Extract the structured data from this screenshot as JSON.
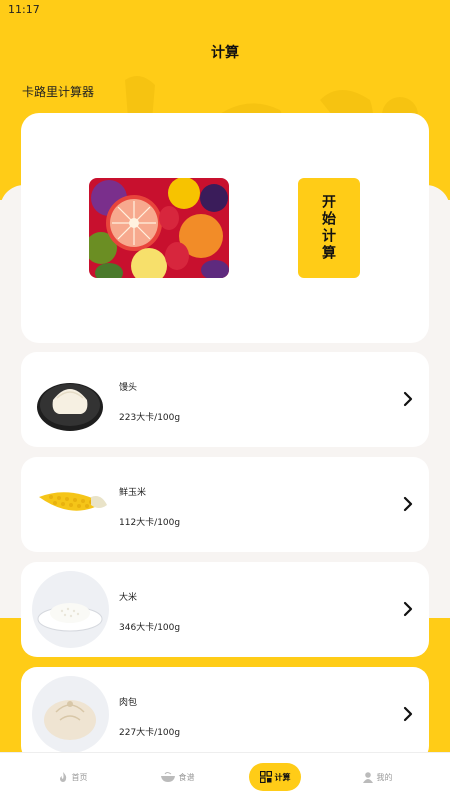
{
  "status_bar": {
    "time": "11:17"
  },
  "header": {
    "title": "计算",
    "subtitle": "卡路里计算器"
  },
  "hero": {
    "calc_button_label": "开始计算"
  },
  "foods": [
    {
      "name": "馒头",
      "calories": "223大卡/100g",
      "icon": "steamed-bun-icon"
    },
    {
      "name": "鲜玉米",
      "calories": "112大卡/100g",
      "icon": "corn-icon"
    },
    {
      "name": "大米",
      "calories": "346大卡/100g",
      "icon": "rice-icon"
    },
    {
      "name": "肉包",
      "calories": "227大卡/100g",
      "icon": "meat-bun-icon"
    }
  ],
  "tabs": [
    {
      "label": "首页",
      "icon": "flame-icon",
      "active": false
    },
    {
      "label": "食谱",
      "icon": "bowl-icon",
      "active": false
    },
    {
      "label": "计算",
      "icon": "grid-icon",
      "active": true
    },
    {
      "label": "我的",
      "icon": "user-icon",
      "active": false
    }
  ],
  "colors": {
    "accent": "#FFCC17",
    "background": "#F7F4F2",
    "card": "#FFFFFF"
  }
}
